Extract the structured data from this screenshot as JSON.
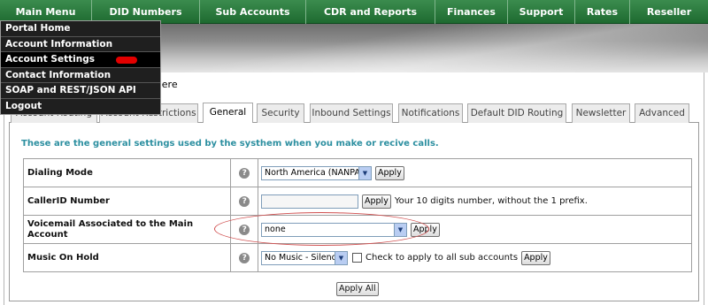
{
  "nav": {
    "items": [
      {
        "label": "Main Menu"
      },
      {
        "label": "DID Numbers"
      },
      {
        "label": "Sub Accounts"
      },
      {
        "label": "CDR and Reports"
      },
      {
        "label": "Finances"
      },
      {
        "label": "Support"
      },
      {
        "label": "Rates"
      },
      {
        "label": "Reseller"
      }
    ]
  },
  "main_menu": {
    "items": [
      {
        "label": "Portal Home"
      },
      {
        "label": "Account Information"
      },
      {
        "label": "Account Settings"
      },
      {
        "label": "Contact Information"
      },
      {
        "label": "SOAP and REST/JSON API"
      },
      {
        "label": "Logout"
      }
    ],
    "highlighted": "Account Settings"
  },
  "partial_link_text": "t here",
  "tabs": {
    "items": [
      {
        "label": "Account Routing"
      },
      {
        "label": "Account Restrictions"
      },
      {
        "label": "General"
      },
      {
        "label": "Security"
      },
      {
        "label": "Inbound Settings"
      },
      {
        "label": "Notifications"
      },
      {
        "label": "Default DID Routing"
      },
      {
        "label": "Newsletter"
      },
      {
        "label": "Advanced"
      }
    ],
    "active": "General"
  },
  "intro_text": "These are the general settings used by the systhem when you make or recive calls.",
  "settings": {
    "dialing_mode": {
      "label": "Dialing Mode",
      "value": "North America (NANPA)",
      "apply": "Apply"
    },
    "callerid": {
      "label": "CallerID Number",
      "value": "",
      "apply": "Apply",
      "hint": "Your 10 digits number, without the 1 prefix."
    },
    "voicemail": {
      "label": "Voicemail Associated to the Main Account",
      "value": "none",
      "apply": "Apply"
    },
    "music_on_hold": {
      "label": "Music On Hold",
      "value": "No Music - Silence",
      "checkbox_label": "Check to apply to all sub accounts",
      "apply": "Apply"
    }
  },
  "help_glyph": "?",
  "dropdown_arrow_glyph": "▼",
  "apply_all": "Apply All",
  "colors": {
    "nav_green": "#2a7a3e",
    "menu_bg": "#1f1f1f",
    "intro_teal": "#2c8fa0",
    "annotation_red": "#d05050"
  }
}
